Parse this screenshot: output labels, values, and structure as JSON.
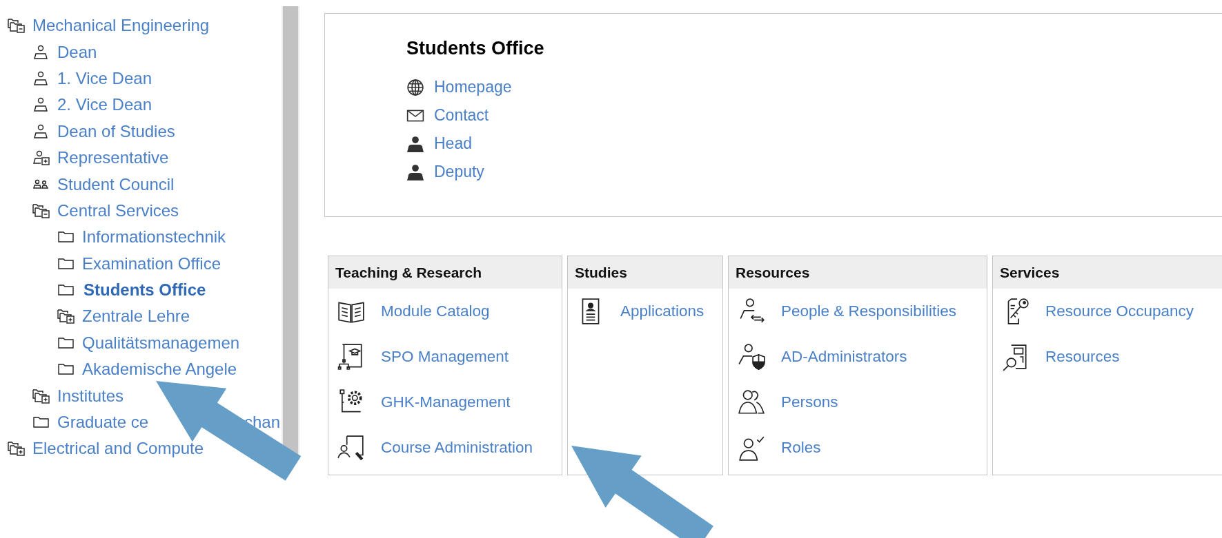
{
  "tree": [
    {
      "label": "Mechanical Engineering",
      "kind": "unit",
      "expanded": true,
      "selected": false,
      "children": [
        {
          "label": "Dean",
          "kind": "person",
          "selected": false
        },
        {
          "label": "1. Vice Dean",
          "kind": "person",
          "selected": false
        },
        {
          "label": "2. Vice Dean",
          "kind": "person",
          "selected": false
        },
        {
          "label": "Dean of Studies",
          "kind": "person",
          "selected": false
        },
        {
          "label": "Representative",
          "kind": "position",
          "expanded": false,
          "selected": false
        },
        {
          "label": "Student Council",
          "kind": "council",
          "selected": false
        },
        {
          "label": "Central Services",
          "kind": "unit",
          "expanded": true,
          "selected": false,
          "children": [
            {
              "label": "Informationstechnik",
              "kind": "folder",
              "selected": false
            },
            {
              "label": "Examination Office",
              "kind": "folder",
              "selected": false
            },
            {
              "label": "Students Office",
              "kind": "folder",
              "selected": true
            },
            {
              "label": "Zentrale Lehre",
              "kind": "unit",
              "expanded": false,
              "selected": false
            },
            {
              "label": "Qualitätsmanagemen",
              "kind": "folder",
              "selected": false
            },
            {
              "label": "Akademische Angele",
              "kind": "folder",
              "selected": false
            }
          ]
        },
        {
          "label": "Institutes",
          "kind": "unit",
          "expanded": false,
          "selected": false
        },
        {
          "label": "Graduate ce",
          "label_end": "chan",
          "kind": "folder",
          "selected": false
        }
      ]
    },
    {
      "label": "Electrical and Compute",
      "kind": "unit",
      "expanded": false,
      "selected": false
    }
  ],
  "office": {
    "title": "Students Office",
    "links": [
      "Homepage",
      "Contact",
      "Head",
      "Deputy"
    ]
  },
  "panels": [
    {
      "title": "Teaching & Research",
      "items": [
        "Module Catalog",
        "SPO Management",
        "GHK-Management",
        "Course Administration"
      ]
    },
    {
      "title": "Studies",
      "items": [
        "Applications"
      ]
    },
    {
      "title": "Resources",
      "items": [
        "People & Responsibilities",
        "AD-Administrators",
        "Persons",
        "Roles"
      ]
    },
    {
      "title": "Services",
      "items": [
        "Resource Occupancy",
        "Resources"
      ]
    }
  ]
}
